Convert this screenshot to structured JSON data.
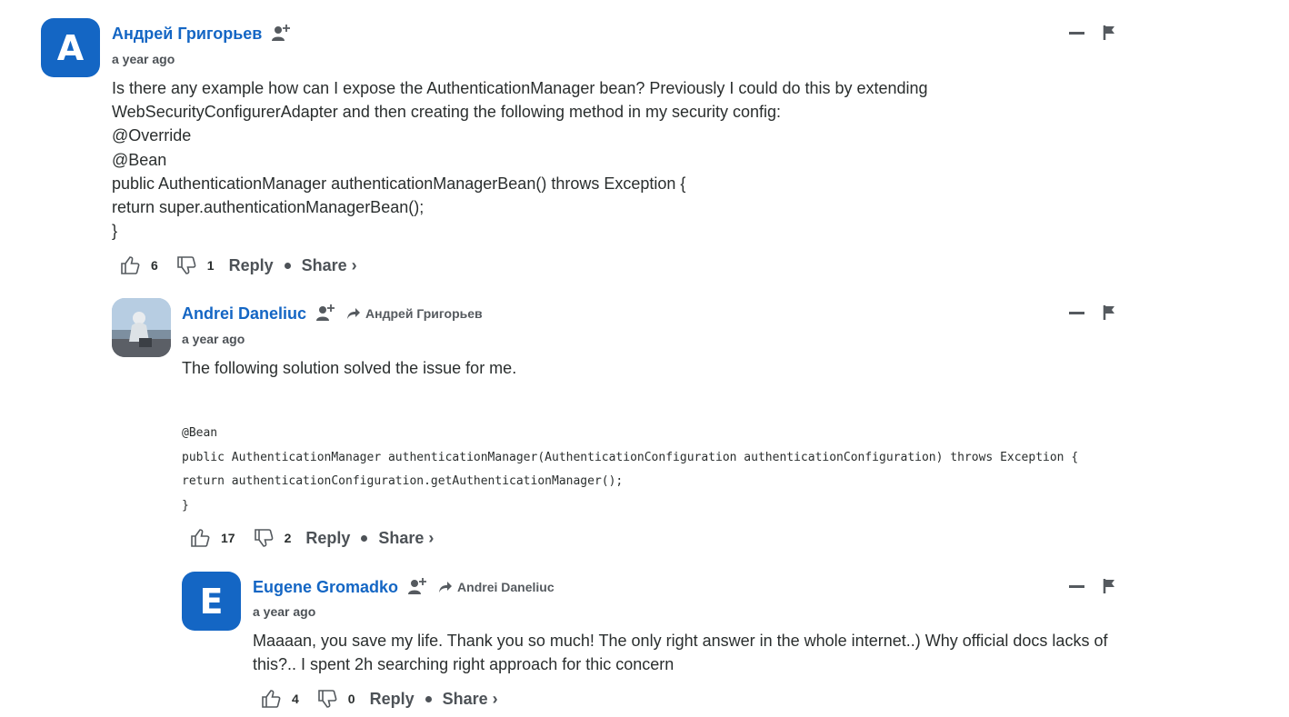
{
  "comments": [
    {
      "author": "Андрей Григорьев",
      "avatar_letter": "A",
      "time": "a year ago",
      "body_lines": [
        "Is there any example how can I expose the AuthenticationManager bean? Previously I could do this by extending",
        "WebSecurityConfigurerAdapter and then creating the following method in my security config:",
        "@Override",
        "@Bean",
        "public AuthenticationManager authenticationManagerBean() throws Exception {",
        "return super.authenticationManagerBean();",
        "}"
      ],
      "upvotes": "6",
      "downvotes": "1",
      "reply_label": "Reply",
      "share_label": "Share ›"
    },
    {
      "author": "Andrei Daneliuc",
      "reply_to": "Андрей Григорьев",
      "time": "a year ago",
      "body_text": "The following solution solved the issue for me.",
      "code_lines": [
        "@Bean",
        "public AuthenticationManager authenticationManager(AuthenticationConfiguration authenticationConfiguration) throws Exception {",
        "return authenticationConfiguration.getAuthenticationManager();",
        "}"
      ],
      "upvotes": "17",
      "downvotes": "2",
      "reply_label": "Reply",
      "share_label": "Share ›"
    },
    {
      "author": "Eugene Gromadko",
      "avatar_letter": "E",
      "reply_to": "Andrei Daneliuc",
      "time": "a year ago",
      "body_lines": [
        "Maaaan, you save my life. Thank you so much! The only right answer in the whole internet..) Why official docs lacks of",
        "this?.. I spent 2h searching right approach for thic concern"
      ],
      "upvotes": "4",
      "downvotes": "0",
      "reply_label": "Reply",
      "share_label": "Share ›"
    }
  ],
  "colors": {
    "author": "#1466c4",
    "avatar_bg": "#1466c4",
    "text": "#2a2e2e",
    "muted": "#555a5f"
  },
  "icons": [
    "follow-user-icon",
    "reply-arrow-icon",
    "thumbs-up-icon",
    "thumbs-down-icon",
    "minimize-icon",
    "flag-icon"
  ]
}
